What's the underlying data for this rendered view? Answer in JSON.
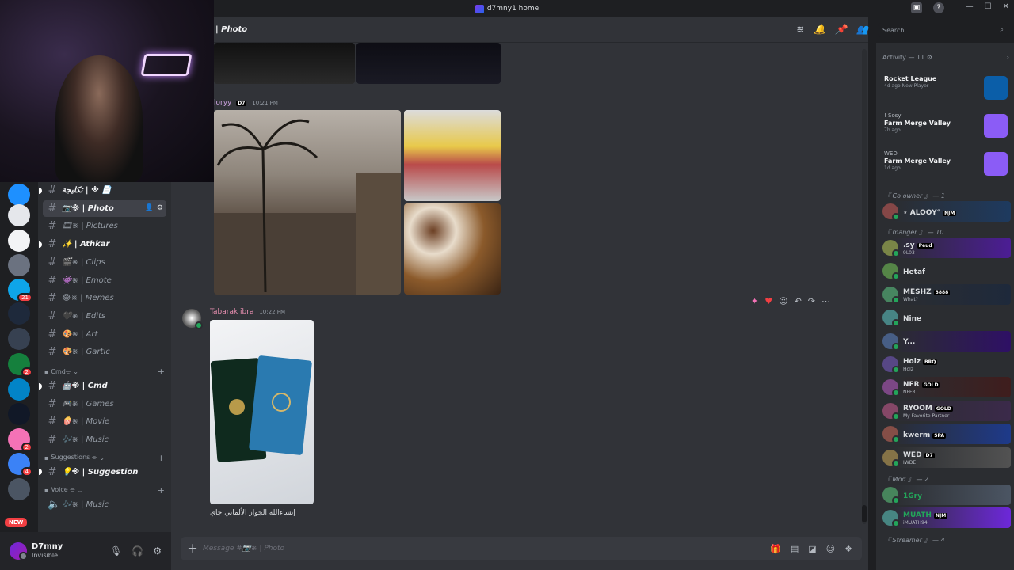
{
  "window": {
    "title": "d7mny1 home"
  },
  "servers": [
    {
      "color": "#1e90ff",
      "badge": ""
    },
    {
      "color": "#e5e7eb",
      "badge": ""
    },
    {
      "color": "#f3f4f6",
      "badge": ""
    },
    {
      "color": "#6b7280",
      "badge": ""
    },
    {
      "color": "#0ea5e9",
      "badge": "21"
    },
    {
      "color": "#1e293b",
      "badge": ""
    },
    {
      "color": "#374151",
      "badge": ""
    },
    {
      "color": "#15803d",
      "badge": "2"
    },
    {
      "color": "#0284c7",
      "badge": ""
    },
    {
      "color": "#111827",
      "badge": ""
    },
    {
      "color": "#f472b6",
      "badge": "2"
    },
    {
      "color": "#3b82f6",
      "badge": "4"
    },
    {
      "color": "#4b5563",
      "badge": ""
    }
  ],
  "new_badge": "NEW",
  "channels": [
    {
      "label": "تكليجة | ※ 📄",
      "active": false,
      "bold": true
    },
    {
      "label": "📷※ | Photo",
      "active": true,
      "bold": true
    },
    {
      "label": "🎞※ | Pictures",
      "active": false,
      "bold": false
    },
    {
      "label": "✨ | Athkar",
      "active": false,
      "bold": true
    },
    {
      "label": "🎬※ | Clips",
      "active": false,
      "bold": false
    },
    {
      "label": "👾※ | Emote",
      "active": false,
      "bold": false
    },
    {
      "label": "😂※ | Memes",
      "active": false,
      "bold": false
    },
    {
      "label": "🖤※ | Edits",
      "active": false,
      "bold": false
    },
    {
      "label": "🎨※ | Art",
      "active": false,
      "bold": false
    },
    {
      "label": "🎨※ | Gartic",
      "active": false,
      "bold": false
    }
  ],
  "categories": [
    {
      "label": "Cmd⌯",
      "channels": [
        {
          "label": "🤖※ | Cmd",
          "bold": true
        },
        {
          "label": "🎮※ | Games",
          "bold": false
        },
        {
          "label": "🍿※ | Movie",
          "bold": false
        },
        {
          "label": "🎶※ | Music",
          "bold": false
        }
      ]
    },
    {
      "label": "Suggestions ⌯",
      "channels": [
        {
          "label": "💡※ | Suggestion",
          "bold": true
        }
      ]
    },
    {
      "label": "Voice ⌯",
      "channels": [
        {
          "label": "🎶※ | Music",
          "bold": false
        }
      ]
    }
  ],
  "user": {
    "name": "D7mny",
    "status": "Invisible"
  },
  "header": {
    "channel": "| Photo"
  },
  "messages": [
    {
      "author": "loryy",
      "badge": "D7",
      "time": "10:21 PM",
      "author_color": "#c9a0dc"
    },
    {
      "author": "Tabarak ibra",
      "time": "10:22 PM",
      "author_color": "#e88fb0",
      "text": "إنشاءالله الجواز الألماني جاي"
    }
  ],
  "composer": {
    "placeholder": "Message #📷※ | Photo"
  },
  "search": {
    "placeholder": "Search"
  },
  "activity": {
    "header": "Activity — 11",
    "items": [
      {
        "person": "",
        "game": "Rocket League",
        "meta": "4d ago  New Player",
        "color": "#0b5ea8"
      },
      {
        "person": "! Sosy",
        "game": "Farm Merge Valley",
        "meta": "7h ago",
        "color": "#8b5cf6"
      },
      {
        "person": "WED",
        "game": "Farm Merge Valley",
        "meta": "1d ago",
        "color": "#8b5cf6"
      }
    ]
  },
  "member_groups": [
    {
      "label": "『 Co owner 』 — 1",
      "members": [
        {
          "name": "⋆ ALOOY°",
          "tag": "NJM",
          "sub": "",
          "color": "#dbdee1",
          "bg": "#1e3a5f"
        }
      ]
    },
    {
      "label": "『 manger 』 — 10",
      "members": [
        {
          "name": ".sy",
          "tag": "Peud",
          "sub": "9L03",
          "color": "#dbdee1",
          "bg": "#4c1d95"
        },
        {
          "name": "Hetaf",
          "tag": "",
          "sub": "",
          "color": "#dbdee1",
          "bg": ""
        },
        {
          "name": "MESHZ",
          "tag": "8888",
          "sub": "What?",
          "color": "#dbdee1",
          "bg": "#1e293b"
        },
        {
          "name": "Nine",
          "tag": "",
          "sub": "",
          "color": "#dbdee1",
          "bg": ""
        },
        {
          "name": "Y...",
          "tag": "",
          "sub": "",
          "color": "#dbdee1",
          "bg": "#2e1065"
        },
        {
          "name": "Holz",
          "tag": "BRQ",
          "sub": "Holz",
          "color": "#dbdee1",
          "bg": ""
        },
        {
          "name": "NFR",
          "tag": "GOLD",
          "sub": "NFFR",
          "color": "#dbdee1",
          "bg": "#3f1d1d"
        },
        {
          "name": "RYOOM",
          "tag": "GOLD",
          "sub": "My Favorite Partner",
          "color": "#dbdee1",
          "bg": "#3b2a4a"
        },
        {
          "name": "kwerm",
          "tag": "SPA",
          "sub": "",
          "color": "#dbdee1",
          "bg": "#1e3a8a"
        },
        {
          "name": "WED",
          "tag": "D7",
          "sub": "IWDE",
          "color": "#dbdee1",
          "bg": "#525252"
        }
      ]
    },
    {
      "label": "『 Mod 』 — 2",
      "members": [
        {
          "name": "1Gry",
          "tag": "",
          "sub": "",
          "color": "#23a55a",
          "bg": "#4b5563"
        },
        {
          "name": "MUATH",
          "tag": "NJM",
          "sub": "iMUATH94",
          "color": "#23a55a",
          "bg": "#6d28d9"
        }
      ]
    },
    {
      "label": "『 Streamer 』 — 4",
      "members": []
    }
  ]
}
